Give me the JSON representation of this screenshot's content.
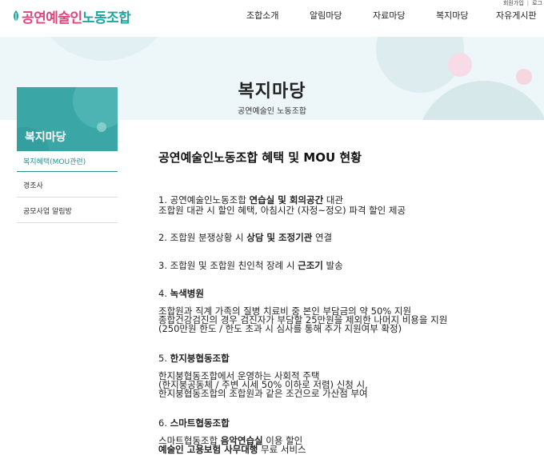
{
  "utility": {
    "join": "회원가입",
    "sep": "|",
    "login": "로그"
  },
  "logo": {
    "part1": "공연예술인",
    "part2": "노동조합"
  },
  "nav": [
    {
      "label": "조합소개"
    },
    {
      "label": "알림마당"
    },
    {
      "label": "자료마당"
    },
    {
      "label": "복지마당"
    },
    {
      "label": "자유게시판"
    }
  ],
  "hero": {
    "title": "복지마당",
    "subtitle": "공연예술인 노동조합"
  },
  "sidebar": {
    "title": "복지마당",
    "items": [
      {
        "label": "복지혜택(MOU관련)"
      },
      {
        "label": "경조사"
      },
      {
        "label": "공모사업 알림방"
      }
    ]
  },
  "content": {
    "title": "공연예술인노동조합 혜택 및 MOU 현황",
    "s1": {
      "l1a": "1. 공연예술인노동조합 ",
      "l1b": "연습실 및 회의공간",
      "l1c": " 대관",
      "l2": "조합원 대관 시 할인 혜택, 아침시간 (자정~정오) 파격 할인 제공"
    },
    "s2": {
      "a": "2. 조합원 분쟁상황 시 ",
      "b": "상담 및 조정기관",
      "c": " 연결"
    },
    "s3": {
      "a": "3. 조합원 및 조합원 친인척 장례 시 ",
      "b": "근조기",
      "c": " 발송"
    },
    "s4": {
      "a": "4. ",
      "b": "녹색병원",
      "l1": "조합원과 직계 가족의 질병 치료비 중 본인 부담금의 약 50% 지원",
      "l2": "종합건강검진의 경우 검진자가 부담할 25만원을 제외한 나머지 비용을 지원",
      "l3": "(250만원 한도 / 한도 초과 시  심사를 통해 추가 지원여부 확정)"
    },
    "s5": {
      "a": "5. ",
      "b": "한지붕협동조합",
      "l1": "한지붕협동조합에서 운영하는 사회적 주택",
      "l2": "(한지붕공동체 / 주변 시세 50% 이하로 저렴) 신청 시,",
      "l3": "한지붕협동조합의 조합원과 같은 조건으로 가산점 부여"
    },
    "s6": {
      "a": "6. ",
      "b": "스마트협동조합",
      "l1a": "스마트협동조합 ",
      "l1b": "음악연습실",
      "l1c": " 이용 할인",
      "l2a": "예술인 고용보험 사무대행",
      "l2b": " 무료 서비스"
    }
  }
}
